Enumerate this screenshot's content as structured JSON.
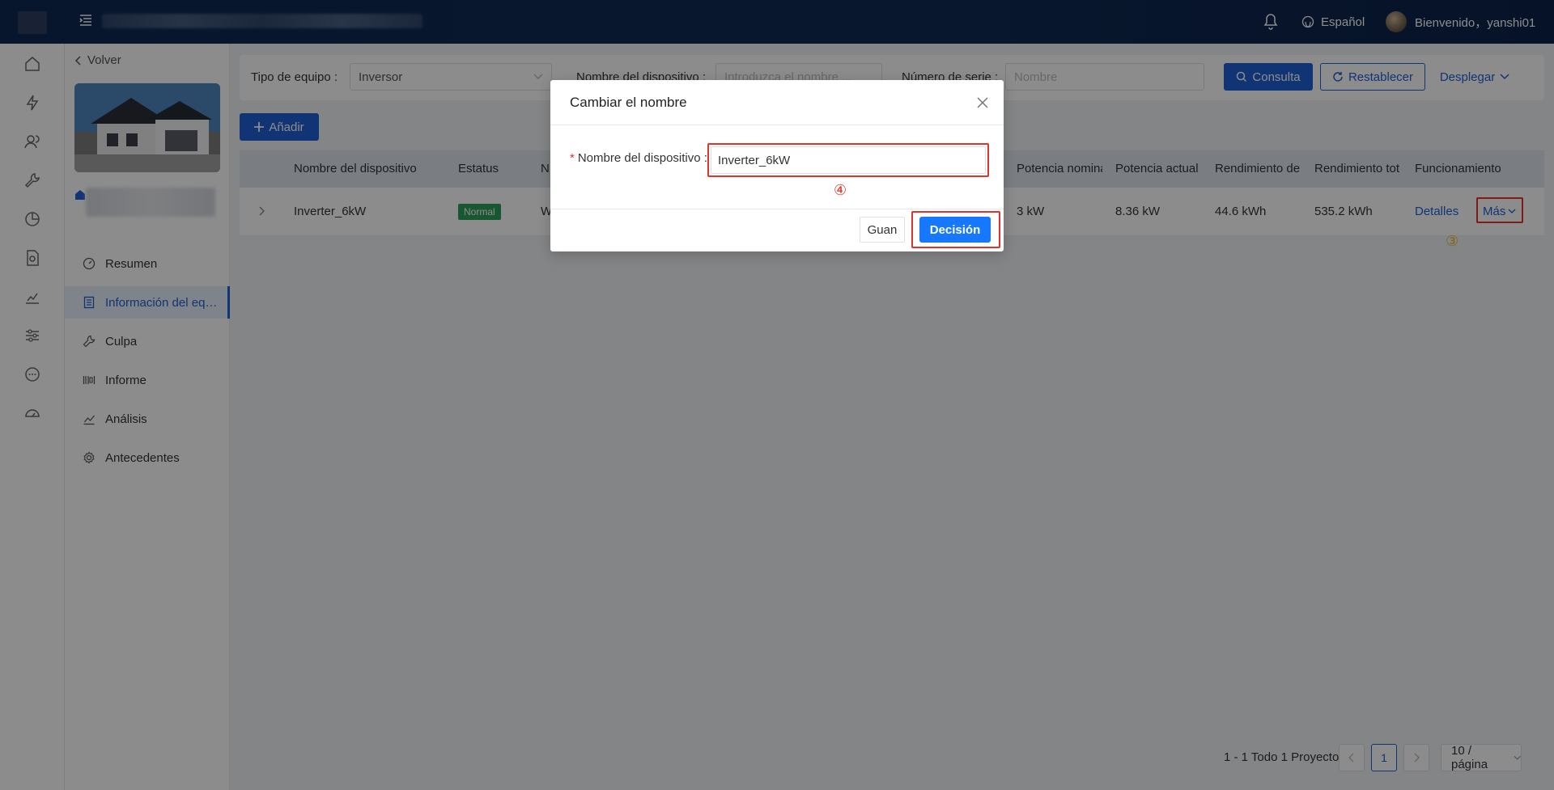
{
  "header": {
    "language": "Español",
    "welcome": "Bienvenido，yanshi01"
  },
  "sidebar": {
    "back_label": "Volver",
    "items": [
      {
        "label": "Resumen",
        "icon": "dashboard-icon"
      },
      {
        "label": "Información del eq…",
        "icon": "device-list-icon",
        "active": true
      },
      {
        "label": "Culpa",
        "icon": "wrench-icon"
      },
      {
        "label": "Informe",
        "icon": "report-icon"
      },
      {
        "label": "Análisis",
        "icon": "chart-line-icon"
      },
      {
        "label": "Antecedentes",
        "icon": "gear-icon"
      }
    ]
  },
  "filters": {
    "equipment_type_label": "Tipo de equipo :",
    "equipment_type_value": "Inversor",
    "device_name_label": "Nombre del dispositivo :",
    "device_name_placeholder": "Introduzca el nombre ...",
    "serial_label": "Número de serie :",
    "serial_placeholder": "Nombre",
    "query_button": "Consulta",
    "reset_button": "Restablecer",
    "expand_button": "Desplegar"
  },
  "add_button": "Añadir",
  "table": {
    "columns": [
      "Nombre del dispositivo",
      "Estatus",
      "N",
      "Potencia nominal",
      "Potencia actual",
      "Rendimiento de",
      "Rendimiento tot",
      "Funcionamiento"
    ],
    "rows": [
      {
        "name": "Inverter_6kW",
        "status": "Normal",
        "col3": "W",
        "rated_power": "3 kW",
        "current_power": "8.36 kW",
        "daily_yield": "44.6 kWh",
        "total_yield": "535.2 kWh",
        "details": "Detalles",
        "more": "Más"
      }
    ]
  },
  "annotations": {
    "step3": "③",
    "step4": "④"
  },
  "pagination": {
    "total": "1 - 1 Todo 1 Proyecto",
    "current_page": "1",
    "page_size": "10 / página"
  },
  "modal": {
    "title": "Cambiar el nombre",
    "field_label": "Nombre del dispositivo :",
    "field_value": "Inverter_6kW",
    "cancel": "Guan",
    "confirm": "Decisión"
  },
  "colors": {
    "primary": "#1f5fd6",
    "highlight": "#e0332b",
    "status_ok": "#2e9e5b",
    "header_bg": "#0d2752"
  }
}
